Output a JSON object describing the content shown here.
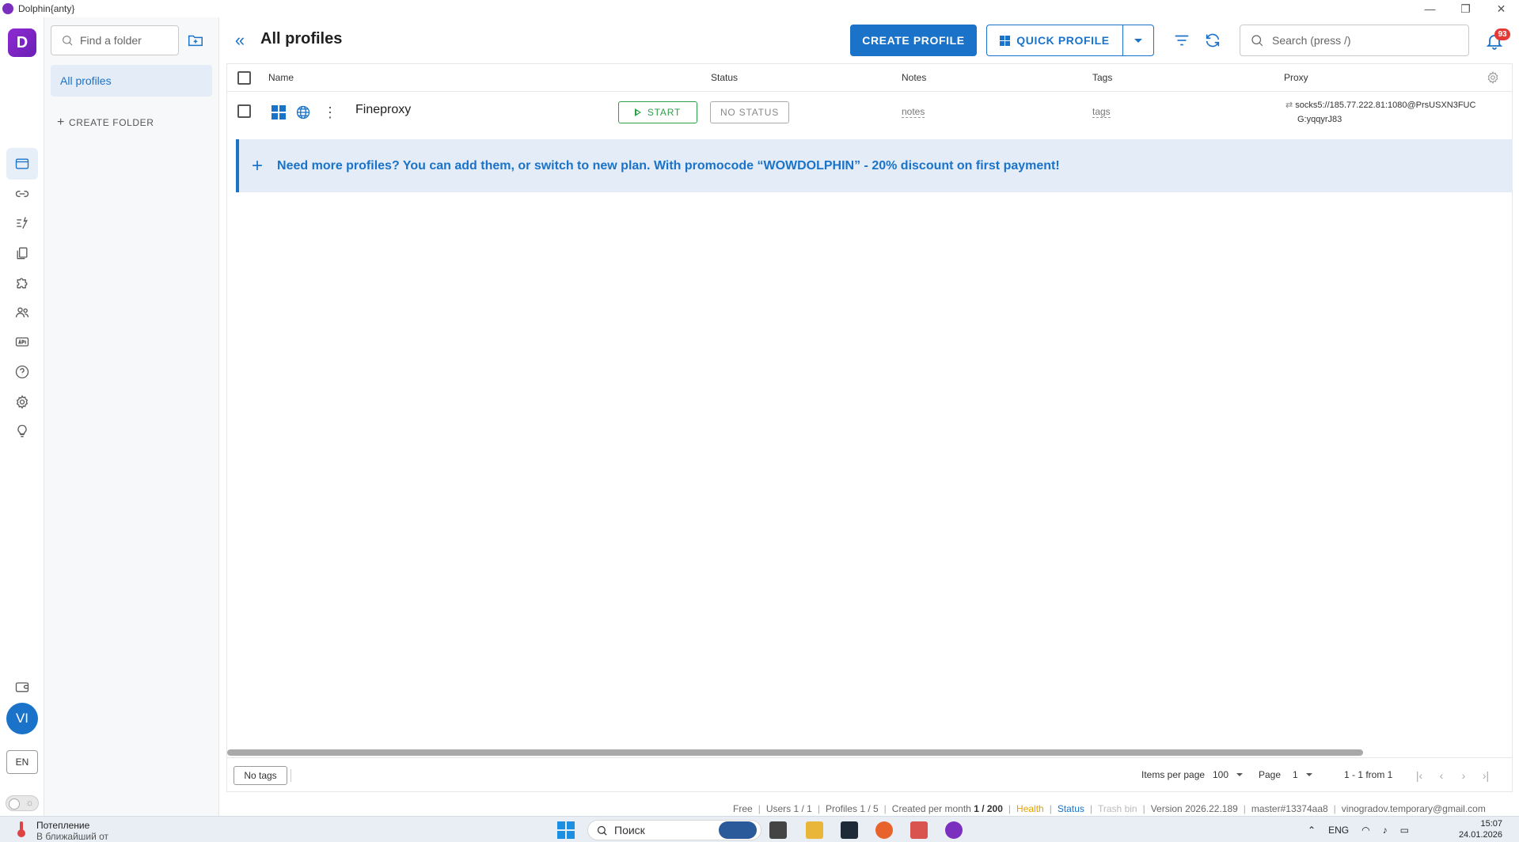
{
  "window": {
    "title": "Dolphin{anty}",
    "minimize": "—",
    "maximize": "❐",
    "close": "✕"
  },
  "rail": {
    "logo": "D",
    "avatar": "VI",
    "language": "EN",
    "theme_icon": "☼"
  },
  "folders": {
    "search_placeholder": "Find a folder",
    "items": [
      {
        "label": "All profiles"
      }
    ],
    "create_label": "CREATE FOLDER"
  },
  "header": {
    "title": "All profiles",
    "create_profile": "CREATE PROFILE",
    "quick_profile": "QUICK PROFILE",
    "search_placeholder": "Search (press /)",
    "notifications_count": "93"
  },
  "table": {
    "columns": {
      "name": "Name",
      "status": "Status",
      "notes": "Notes",
      "tags": "Tags",
      "proxy": "Proxy"
    },
    "rows": [
      {
        "name": "Fineproxy",
        "start_label": "START",
        "status": "NO STATUS",
        "notes": "notes",
        "tags": "tags",
        "proxy_line1": "socks5://185.77.222.81:1080@PrsUSXN3FUC",
        "proxy_line2": "G:yqqyrJ83"
      }
    ],
    "promo": "Need more profiles? You can add them, or switch to new plan. With promocode “WOWDOLPHIN” - 20% discount on first payment!"
  },
  "footer": {
    "no_tags": "No tags",
    "items_per_page_label": "Items per page",
    "items_per_page": "100",
    "page_label": "Page",
    "page": "1",
    "range": "1 - 1 from 1"
  },
  "statusbar": {
    "plan": "Free",
    "users": "Users 1 / 1",
    "profiles": "Profiles 1 / 5",
    "created_label": "Created per month",
    "created_value": "1 / 200",
    "health": "Health",
    "status": "Status",
    "trash": "Trash bin",
    "version": "Version 2026.22.189",
    "branch": "master#13374aa8",
    "email": "vinogradov.temporary@gmail.com"
  },
  "taskbar": {
    "weather_title": "Потепление",
    "weather_sub": "В ближайший от",
    "search": "Поиск",
    "lang": "ENG",
    "time": "15:07",
    "date": "24.01.2026"
  }
}
